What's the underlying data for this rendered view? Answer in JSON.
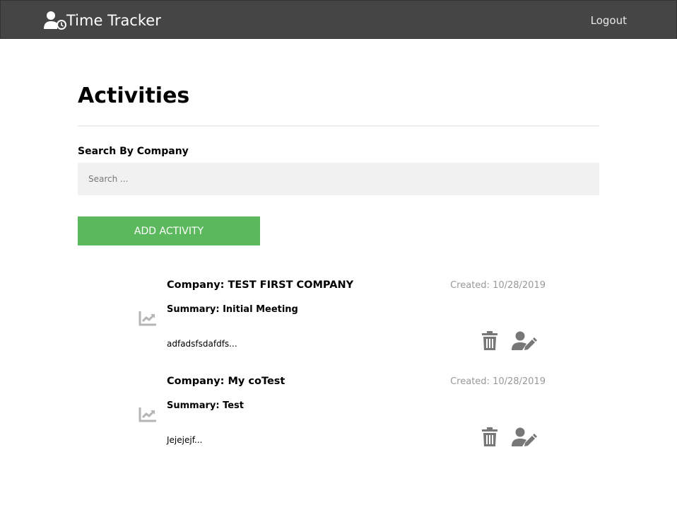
{
  "navbar": {
    "brand": "Time Tracker",
    "brand_icon": "user-clock-icon",
    "logout_label": "Logout",
    "bg_color": "#454545"
  },
  "page": {
    "title": "Activities"
  },
  "search": {
    "label": "Search By Company",
    "placeholder": "Search ...",
    "value": ""
  },
  "actions": {
    "add_label": "ADD ACTIVITY",
    "add_color": "#5cb85c"
  },
  "activities": [
    {
      "company": "Company: TEST FIRST COMPANY",
      "created": "Created: 10/28/2019",
      "summary": "Summary: Initial Meeting",
      "description": "adfadsfsdafdfs...",
      "icon": "trend-chart-icon"
    },
    {
      "company": "Company: My coTest",
      "created": "Created: 10/28/2019",
      "summary": "Summary: Test",
      "description": "Jejejejf...",
      "icon": "trend-chart-icon"
    }
  ],
  "colors": {
    "icon_gray": "#777777",
    "trend_icon_gray": "#b5b5b5",
    "muted_text": "#999999"
  }
}
